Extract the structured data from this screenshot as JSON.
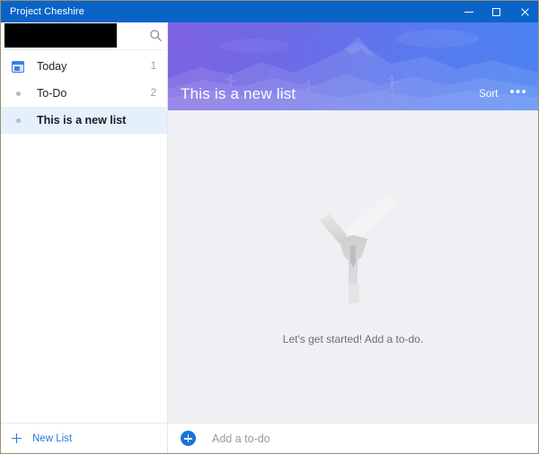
{
  "window": {
    "title": "Project Cheshire",
    "controls": {
      "minimize": "minimize-button",
      "maximize": "maximize-button",
      "close": "close-button"
    },
    "titlebar_color": "#0a64c8"
  },
  "sidebar": {
    "search": {
      "value": "",
      "placeholder": "",
      "redacted": true,
      "icon": "search-icon"
    },
    "items": [
      {
        "label": "Today",
        "count": "1",
        "icon": "calendar-icon",
        "selected": false
      },
      {
        "label": "To-Do",
        "count": "2",
        "icon": "dot-icon",
        "selected": false
      },
      {
        "label": "This is a new list",
        "count": "",
        "icon": "dot-icon",
        "selected": true
      }
    ],
    "footer": {
      "new_list_label": "New List",
      "new_list_icon": "plus-icon",
      "accent_color": "#2b7cd3"
    }
  },
  "main": {
    "hero": {
      "title": "This is a new list",
      "sort_label": "Sort",
      "more_label": "•••",
      "gradient_from": "#7d62e2",
      "gradient_to": "#4a82f2",
      "artwork": "mountain-landscape"
    },
    "empty_state": {
      "illustration": "person-celebrating-checkmark",
      "message": "Let's get started! Add a to-do."
    },
    "add_todo": {
      "placeholder": "Add a to-do",
      "value": "",
      "icon": "circle-plus-icon",
      "accent_color": "#1a73d8"
    },
    "background_color": "#eef0f4"
  }
}
